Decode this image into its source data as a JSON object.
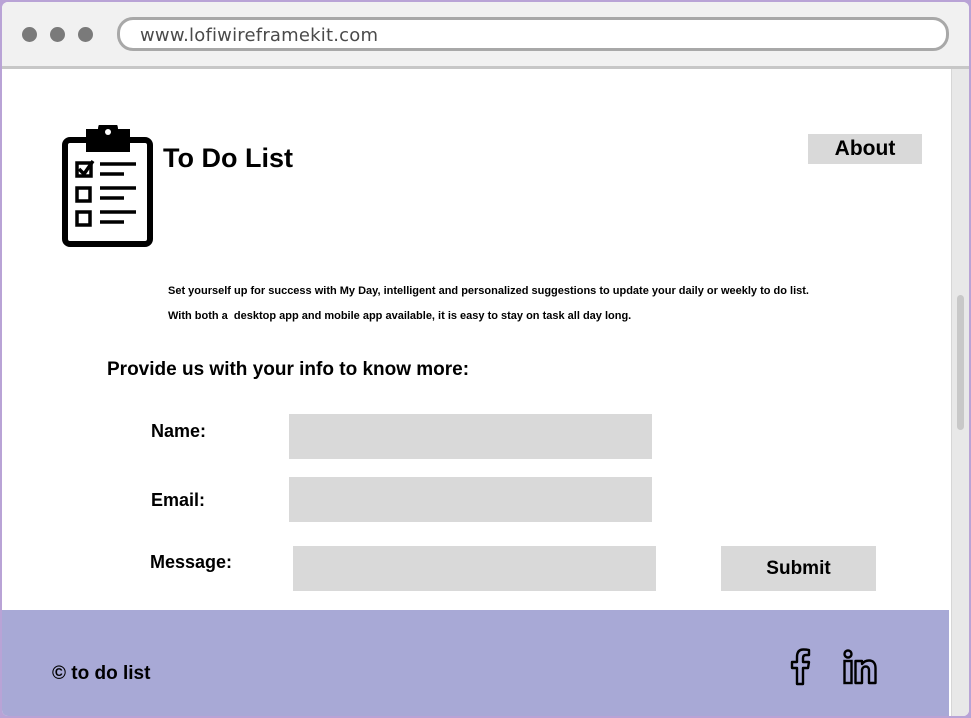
{
  "browser": {
    "url": "www.lofiwireframekit.com"
  },
  "header": {
    "logo_icon": "clipboard-checklist-icon",
    "title": "To Do List",
    "about_label": "About"
  },
  "intro": {
    "line1": "Set yourself up for success with My Day, intelligent and personalized suggestions to update your daily or weekly to do list.",
    "line2": "With both a  desktop app and mobile app available, it is easy to stay on task all day long."
  },
  "form": {
    "heading": "Provide us with your info to know more:",
    "name_label": "Name:",
    "name_value": "",
    "email_label": "Email:",
    "email_value": "",
    "message_label": "Message:",
    "message_value": "",
    "submit_label": "Submit"
  },
  "footer": {
    "copyright": "© to do list",
    "social": [
      {
        "icon": "facebook-icon"
      },
      {
        "icon": "linkedin-icon"
      }
    ]
  },
  "colors": {
    "footer_bg": "#a8a9d6",
    "field_bg": "#d9d9d9",
    "outer_frame": "#b9a3d6"
  }
}
